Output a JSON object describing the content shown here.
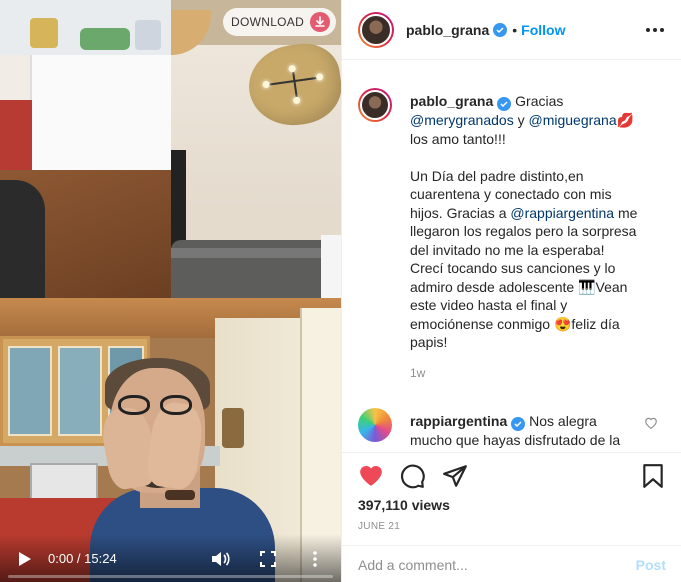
{
  "video": {
    "download_label": "DOWNLOAD",
    "timecode": "0:00 / 15:24",
    "progress_fraction": 0.0
  },
  "header": {
    "username": "pablo_grana",
    "separator": "•",
    "follow_label": "Follow"
  },
  "caption": {
    "username": "pablo_grana",
    "parts": {
      "p1": "Gracias ",
      "m1": "@merygranados",
      "p2": " y ",
      "m2": "@miguegrana",
      "p3": "💋",
      "p4": " los amo tanto!!!",
      "p5": "Un Día del padre distinto,en cuarentena y conectado con mis hijos. Gracias a ",
      "m3": "@rappiargentina",
      "p6": " me llegaron los regalos pero la sorpresa del invitado no me la esperaba! Crecí tocando sus canciones y lo admiro desde adolescente 🎹Vean este video hasta el final y emociónense conmigo 😍feliz día papis!"
    },
    "time": "1w"
  },
  "comment": {
    "username": "rappiargentina",
    "text": " Nos alegra mucho que hayas disfrutado de la sorpresa! No te pudimos mandar a Lito por Rappi junto al"
  },
  "actions": {
    "views": "397,110 views",
    "date": "JUNE 21",
    "comment_placeholder": "Add a comment...",
    "post_label": "Post"
  },
  "colors": {
    "accent": "#0095f6",
    "like": "#ed4956",
    "verified": "#3897f0",
    "mention": "#00376b"
  }
}
